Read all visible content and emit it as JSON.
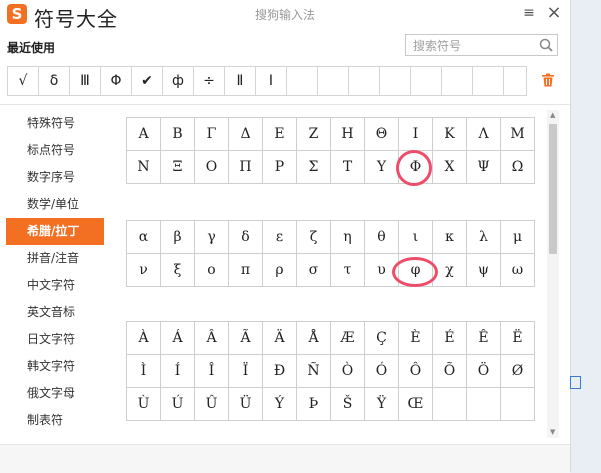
{
  "titlebar": {
    "logo_char": "S",
    "title": "符号大全",
    "subtitle": "搜狗输入法",
    "settings_label": "≡",
    "close_label": "×"
  },
  "recent": {
    "label": "最近使用",
    "items": [
      "√",
      "δ",
      "Ⅲ",
      "Φ",
      "✔",
      "ф",
      "÷",
      "Ⅱ",
      "Ⅰ",
      "",
      "",
      "",
      "",
      "",
      "",
      "",
      ""
    ]
  },
  "search": {
    "placeholder": "搜索符号",
    "value": ""
  },
  "sidebar": {
    "items": [
      {
        "label": "特殊符号",
        "active": false
      },
      {
        "label": "标点符号",
        "active": false
      },
      {
        "label": "数字序号",
        "active": false
      },
      {
        "label": "数学/单位",
        "active": false
      },
      {
        "label": "希腊/拉丁",
        "active": true
      },
      {
        "label": "拼音/注音",
        "active": false
      },
      {
        "label": "中文字符",
        "active": false
      },
      {
        "label": "英文音标",
        "active": false
      },
      {
        "label": "日文字符",
        "active": false
      },
      {
        "label": "韩文字符",
        "active": false
      },
      {
        "label": "俄文字母",
        "active": false
      },
      {
        "label": "制表符",
        "active": false
      }
    ]
  },
  "greek_upper": [
    "Α",
    "Β",
    "Γ",
    "Δ",
    "Ε",
    "Ζ",
    "Η",
    "Θ",
    "Ι",
    "Κ",
    "Λ",
    "Μ",
    "Ν",
    "Ξ",
    "Ο",
    "Π",
    "Ρ",
    "Σ",
    "Τ",
    "Υ",
    "Φ",
    "Χ",
    "Ψ",
    "Ω"
  ],
  "greek_lower": [
    "α",
    "β",
    "γ",
    "δ",
    "ε",
    "ζ",
    "η",
    "θ",
    "ι",
    "κ",
    "λ",
    "μ",
    "ν",
    "ξ",
    "ο",
    "π",
    "ρ",
    "σ",
    "τ",
    "υ",
    "φ",
    "χ",
    "ψ",
    "ω"
  ],
  "latin": [
    "À",
    "Á",
    "Â",
    "Ã",
    "Ä",
    "Å",
    "Æ",
    "Ç",
    "È",
    "É",
    "Ê",
    "Ë",
    "Ì",
    "Í",
    "Î",
    "Ï",
    "Ð",
    "Ñ",
    "Ò",
    "Ó",
    "Ô",
    "Õ",
    "Ö",
    "Ø",
    "Ù",
    "Ú",
    "Û",
    "Ü",
    "Ý",
    "Þ",
    "Š",
    "Ÿ",
    "Œ",
    "",
    "",
    ""
  ],
  "colors": {
    "accent": "#f36f21",
    "highlight_circle": "#ee4d6a"
  }
}
